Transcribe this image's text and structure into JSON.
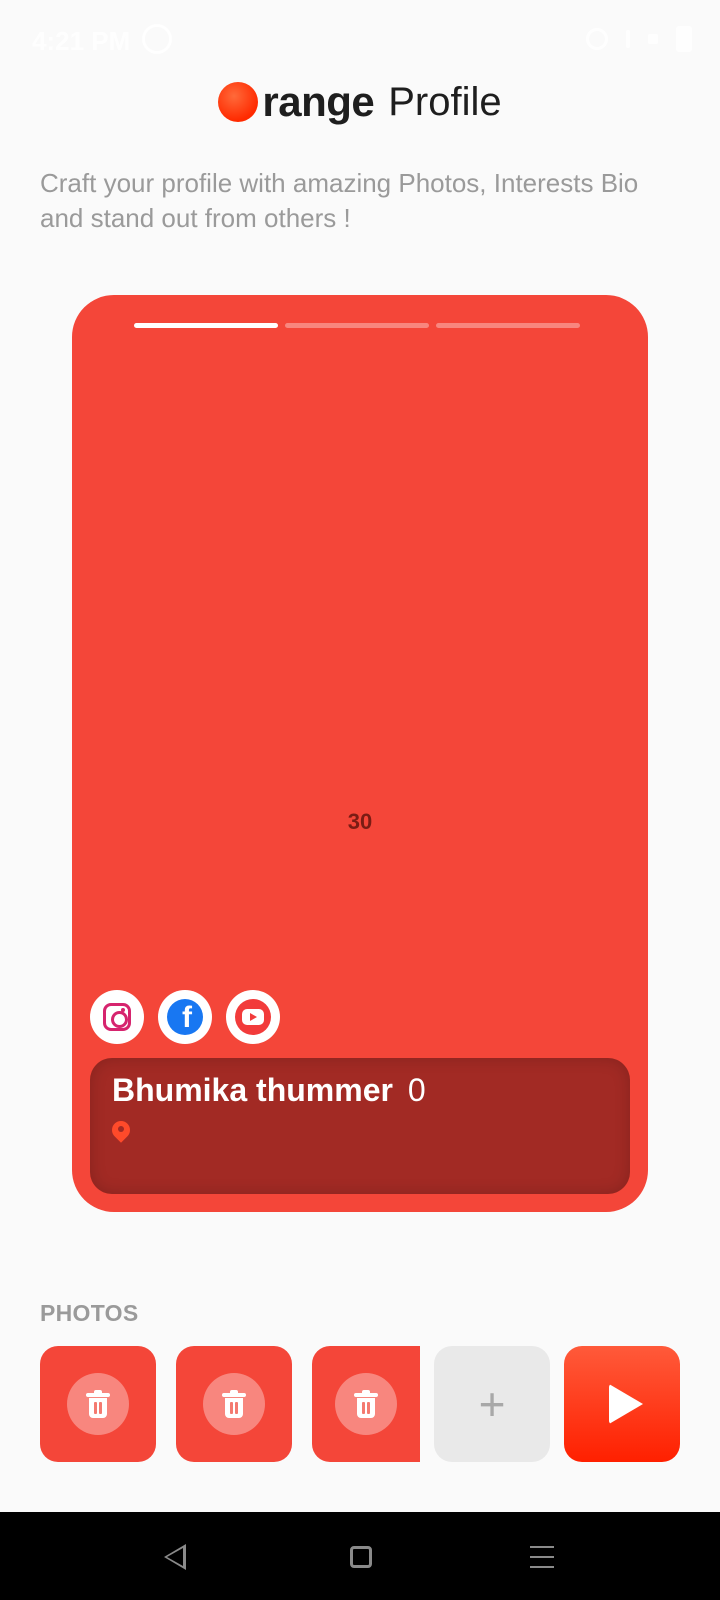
{
  "status_bar": {
    "time": "4:21 PM"
  },
  "header": {
    "logo_text": "range",
    "title": "Profile"
  },
  "subtitle": "Craft your profile with amazing Photos, Interests Bio and stand out from others !",
  "card": {
    "progress_segments": 3,
    "active_segment": 1,
    "center_text": "30",
    "name": "Bhumika thummer",
    "age": "0",
    "socials": [
      "instagram-icon",
      "facebook-icon",
      "youtube-icon"
    ]
  },
  "photos": {
    "label": "PHOTOS",
    "tiles": 3,
    "add_symbol": "+"
  },
  "colors": {
    "brand": "#f44639",
    "info_box": "#a22a24",
    "accent_gradient_top": "#ff5a3a"
  }
}
